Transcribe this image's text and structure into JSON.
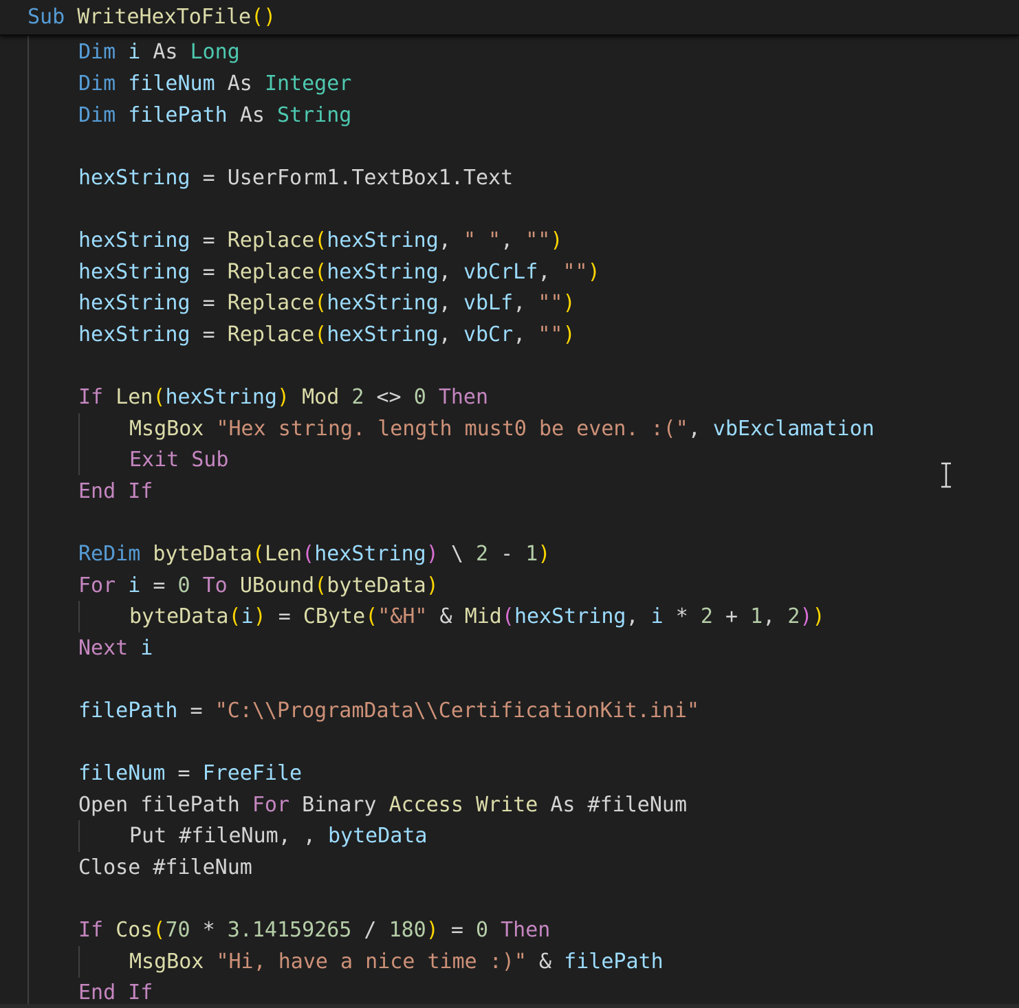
{
  "colors": {
    "background": "#1f1f1f",
    "keyword": "#569cd6",
    "control": "#c586c0",
    "function": "#dcdcaa",
    "variable": "#9cdcfe",
    "type": "#4ec9b0",
    "string": "#ce9178",
    "number": "#b5cea8",
    "plain": "#d4d4d4",
    "bracket_level1": "#ffd700",
    "bracket_level2": "#da70d6",
    "indent_guide": "#404040"
  },
  "cursor_icon": "text-cursor-ibeam-icon",
  "sticky_header": [
    {
      "t": "Sub",
      "c": "kw"
    },
    {
      "t": " ",
      "c": "pl"
    },
    {
      "t": "WriteHexToFile",
      "c": "fn"
    },
    {
      "t": "()",
      "c": "b1"
    }
  ],
  "code_lines": [
    [
      {
        "t": "Dim",
        "c": "kw"
      },
      {
        "t": " i ",
        "c": "var"
      },
      {
        "t": "As",
        "c": "pl"
      },
      {
        "t": " ",
        "c": "pl"
      },
      {
        "t": "Long",
        "c": "type"
      }
    ],
    [
      {
        "t": "Dim",
        "c": "kw"
      },
      {
        "t": " fileNum ",
        "c": "var"
      },
      {
        "t": "As",
        "c": "pl"
      },
      {
        "t": " ",
        "c": "pl"
      },
      {
        "t": "Integer",
        "c": "type"
      }
    ],
    [
      {
        "t": "Dim",
        "c": "kw"
      },
      {
        "t": " filePath ",
        "c": "var"
      },
      {
        "t": "As",
        "c": "pl"
      },
      {
        "t": " ",
        "c": "pl"
      },
      {
        "t": "String",
        "c": "type"
      }
    ],
    [],
    [
      {
        "t": "hexString",
        "c": "var"
      },
      {
        "t": " = ",
        "c": "op"
      },
      {
        "t": "UserForm1.TextBox1.Text",
        "c": "pl"
      }
    ],
    [],
    [
      {
        "t": "hexString",
        "c": "var"
      },
      {
        "t": " = ",
        "c": "op"
      },
      {
        "t": "Replace",
        "c": "fn"
      },
      {
        "t": "(",
        "c": "b1"
      },
      {
        "t": "hexString",
        "c": "var"
      },
      {
        "t": ", ",
        "c": "pl"
      },
      {
        "t": "\" \"",
        "c": "str"
      },
      {
        "t": ", ",
        "c": "pl"
      },
      {
        "t": "\"\"",
        "c": "str"
      },
      {
        "t": ")",
        "c": "b1"
      }
    ],
    [
      {
        "t": "hexString",
        "c": "var"
      },
      {
        "t": " = ",
        "c": "op"
      },
      {
        "t": "Replace",
        "c": "fn"
      },
      {
        "t": "(",
        "c": "b1"
      },
      {
        "t": "hexString",
        "c": "var"
      },
      {
        "t": ", ",
        "c": "pl"
      },
      {
        "t": "vbCrLf",
        "c": "var"
      },
      {
        "t": ", ",
        "c": "pl"
      },
      {
        "t": "\"\"",
        "c": "str"
      },
      {
        "t": ")",
        "c": "b1"
      }
    ],
    [
      {
        "t": "hexString",
        "c": "var"
      },
      {
        "t": " = ",
        "c": "op"
      },
      {
        "t": "Replace",
        "c": "fn"
      },
      {
        "t": "(",
        "c": "b1"
      },
      {
        "t": "hexString",
        "c": "var"
      },
      {
        "t": ", ",
        "c": "pl"
      },
      {
        "t": "vbLf",
        "c": "var"
      },
      {
        "t": ", ",
        "c": "pl"
      },
      {
        "t": "\"\"",
        "c": "str"
      },
      {
        "t": ")",
        "c": "b1"
      }
    ],
    [
      {
        "t": "hexString",
        "c": "var"
      },
      {
        "t": " = ",
        "c": "op"
      },
      {
        "t": "Replace",
        "c": "fn"
      },
      {
        "t": "(",
        "c": "b1"
      },
      {
        "t": "hexString",
        "c": "var"
      },
      {
        "t": ", ",
        "c": "pl"
      },
      {
        "t": "vbCr",
        "c": "var"
      },
      {
        "t": ", ",
        "c": "pl"
      },
      {
        "t": "\"\"",
        "c": "str"
      },
      {
        "t": ")",
        "c": "b1"
      }
    ],
    [],
    [
      {
        "t": "If",
        "c": "ctrl"
      },
      {
        "t": " ",
        "c": "pl"
      },
      {
        "t": "Len",
        "c": "fn"
      },
      {
        "t": "(",
        "c": "b1"
      },
      {
        "t": "hexString",
        "c": "var"
      },
      {
        "t": ")",
        "c": "b1"
      },
      {
        "t": " ",
        "c": "pl"
      },
      {
        "t": "Mod",
        "c": "fn"
      },
      {
        "t": " ",
        "c": "pl"
      },
      {
        "t": "2",
        "c": "num"
      },
      {
        "t": " <> ",
        "c": "op"
      },
      {
        "t": "0",
        "c": "num"
      },
      {
        "t": " ",
        "c": "pl"
      },
      {
        "t": "Then",
        "c": "ctrl"
      }
    ],
    [
      {
        "t": "MsgBox",
        "c": "fn"
      },
      {
        "t": " ",
        "c": "pl"
      },
      {
        "t": "\"Hex string. length must0 be even. :(\"",
        "c": "str"
      },
      {
        "t": ", ",
        "c": "pl"
      },
      {
        "t": "vbExclamation",
        "c": "var"
      }
    ],
    [
      {
        "t": "Exit Sub",
        "c": "ctrl"
      }
    ],
    [
      {
        "t": "End If",
        "c": "ctrl"
      }
    ],
    [],
    [
      {
        "t": "ReDim",
        "c": "kw"
      },
      {
        "t": " ",
        "c": "pl"
      },
      {
        "t": "byteData",
        "c": "fn"
      },
      {
        "t": "(",
        "c": "b1"
      },
      {
        "t": "Len",
        "c": "fn"
      },
      {
        "t": "(",
        "c": "b2"
      },
      {
        "t": "hexString",
        "c": "var"
      },
      {
        "t": ")",
        "c": "b2"
      },
      {
        "t": " \\ ",
        "c": "op"
      },
      {
        "t": "2",
        "c": "num"
      },
      {
        "t": " - ",
        "c": "op"
      },
      {
        "t": "1",
        "c": "num"
      },
      {
        "t": ")",
        "c": "b1"
      }
    ],
    [
      {
        "t": "For",
        "c": "ctrl"
      },
      {
        "t": " i ",
        "c": "var"
      },
      {
        "t": "= ",
        "c": "op"
      },
      {
        "t": "0",
        "c": "num"
      },
      {
        "t": " ",
        "c": "pl"
      },
      {
        "t": "To",
        "c": "ctrl"
      },
      {
        "t": " ",
        "c": "pl"
      },
      {
        "t": "UBound",
        "c": "fn"
      },
      {
        "t": "(",
        "c": "b1"
      },
      {
        "t": "byteData",
        "c": "fn"
      },
      {
        "t": ")",
        "c": "b1"
      }
    ],
    [
      {
        "t": "byteData",
        "c": "fn"
      },
      {
        "t": "(",
        "c": "b1"
      },
      {
        "t": "i",
        "c": "var"
      },
      {
        "t": ")",
        "c": "b1"
      },
      {
        "t": " = ",
        "c": "op"
      },
      {
        "t": "CByte",
        "c": "fn"
      },
      {
        "t": "(",
        "c": "b1"
      },
      {
        "t": "\"&H\"",
        "c": "str"
      },
      {
        "t": " & ",
        "c": "op"
      },
      {
        "t": "Mid",
        "c": "fn"
      },
      {
        "t": "(",
        "c": "b2"
      },
      {
        "t": "hexString",
        "c": "var"
      },
      {
        "t": ", ",
        "c": "pl"
      },
      {
        "t": "i",
        "c": "var"
      },
      {
        "t": " * ",
        "c": "op"
      },
      {
        "t": "2",
        "c": "num"
      },
      {
        "t": " + ",
        "c": "op"
      },
      {
        "t": "1",
        "c": "num"
      },
      {
        "t": ", ",
        "c": "pl"
      },
      {
        "t": "2",
        "c": "num"
      },
      {
        "t": ")",
        "c": "b2"
      },
      {
        "t": ")",
        "c": "b1"
      }
    ],
    [
      {
        "t": "Next",
        "c": "ctrl"
      },
      {
        "t": " i",
        "c": "var"
      }
    ],
    [],
    [
      {
        "t": "filePath",
        "c": "var"
      },
      {
        "t": " = ",
        "c": "op"
      },
      {
        "t": "\"C:\\\\ProgramData\\\\CertificationKit.ini\"",
        "c": "str"
      }
    ],
    [],
    [
      {
        "t": "fileNum",
        "c": "var"
      },
      {
        "t": " = ",
        "c": "op"
      },
      {
        "t": "FreeFile",
        "c": "var"
      }
    ],
    [
      {
        "t": "Open filePath ",
        "c": "pl"
      },
      {
        "t": "For",
        "c": "ctrl"
      },
      {
        "t": " ",
        "c": "pl"
      },
      {
        "t": "Binary",
        "c": "pl"
      },
      {
        "t": " ",
        "c": "pl"
      },
      {
        "t": "Access",
        "c": "fn"
      },
      {
        "t": " ",
        "c": "pl"
      },
      {
        "t": "Write",
        "c": "fn"
      },
      {
        "t": " As #fileNum",
        "c": "pl"
      }
    ],
    [
      {
        "t": "Put #fileNum, , ",
        "c": "pl"
      },
      {
        "t": "byteData",
        "c": "var"
      }
    ],
    [
      {
        "t": "Close #fileNum",
        "c": "pl"
      }
    ],
    [],
    [
      {
        "t": "If",
        "c": "ctrl"
      },
      {
        "t": " ",
        "c": "pl"
      },
      {
        "t": "Cos",
        "c": "fn"
      },
      {
        "t": "(",
        "c": "b1"
      },
      {
        "t": "70",
        "c": "num"
      },
      {
        "t": " * ",
        "c": "op"
      },
      {
        "t": "3.14159265",
        "c": "num"
      },
      {
        "t": " / ",
        "c": "op"
      },
      {
        "t": "180",
        "c": "num"
      },
      {
        "t": ")",
        "c": "b1"
      },
      {
        "t": " = ",
        "c": "op"
      },
      {
        "t": "0",
        "c": "num"
      },
      {
        "t": " ",
        "c": "pl"
      },
      {
        "t": "Then",
        "c": "ctrl"
      }
    ],
    [
      {
        "t": "MsgBox",
        "c": "fn"
      },
      {
        "t": " ",
        "c": "pl"
      },
      {
        "t": "\"Hi, have a nice time :)\"",
        "c": "str"
      },
      {
        "t": " & ",
        "c": "op"
      },
      {
        "t": "filePath",
        "c": "var"
      }
    ],
    [
      {
        "t": "End If",
        "c": "ctrl"
      }
    ]
  ]
}
